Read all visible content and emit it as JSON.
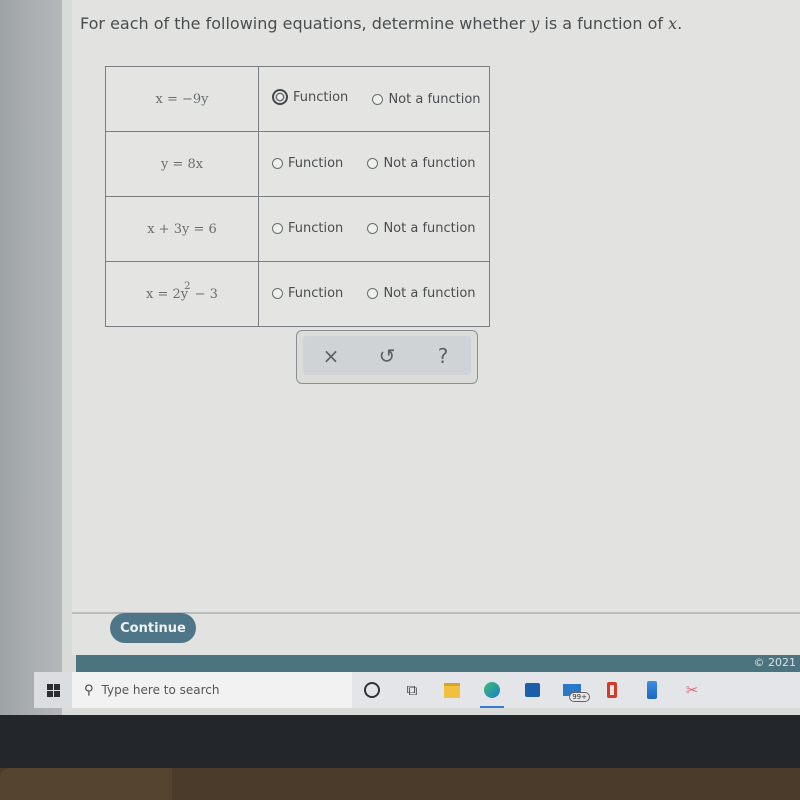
{
  "question": {
    "prefix": "For each of the following equations, determine whether ",
    "var_y": "y",
    "middle": " is a function of ",
    "var_x": "x",
    "suffix": "."
  },
  "rows": [
    {
      "equation": "x = −9y",
      "exponent": "",
      "tail": "",
      "options": [
        "Function",
        "Not a function"
      ],
      "focused": "Function"
    },
    {
      "equation": "y = 8x",
      "exponent": "",
      "tail": "",
      "options": [
        "Function",
        "Not a function"
      ],
      "focused": null
    },
    {
      "equation": "x + 3y = 6",
      "exponent": "",
      "tail": "",
      "options": [
        "Function",
        "Not a function"
      ],
      "focused": null
    },
    {
      "equation": "x = 2y",
      "exponent": "2",
      "tail": " − 3",
      "options": [
        "Function",
        "Not a function"
      ],
      "focused": null
    }
  ],
  "toolbar": {
    "clear_icon": "×",
    "undo_icon": "↺",
    "help_icon": "?"
  },
  "continue_label": "Continue",
  "copyright": "© 2021",
  "taskbar": {
    "search_placeholder": "Type here to search",
    "mail_badge": "99+",
    "apps": [
      "cortana",
      "task-view",
      "file-explorer",
      "edge",
      "store",
      "mail",
      "office",
      "phone",
      "snipping-tool"
    ]
  }
}
